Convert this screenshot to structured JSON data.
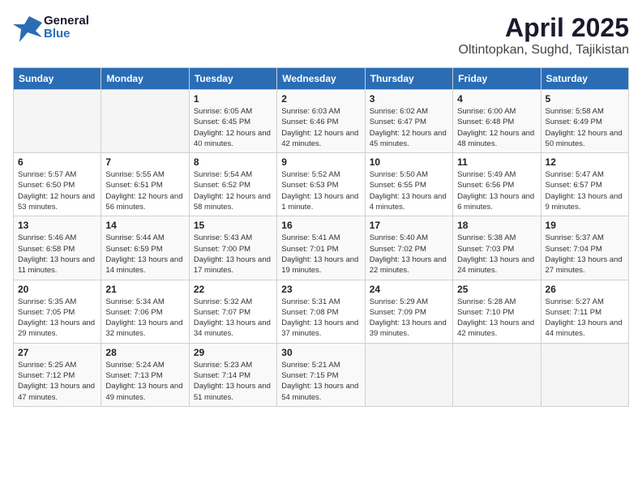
{
  "header": {
    "logo_general": "General",
    "logo_blue": "Blue",
    "title": "April 2025",
    "subtitle": "Oltintopkan, Sughd, Tajikistan"
  },
  "weekdays": [
    "Sunday",
    "Monday",
    "Tuesday",
    "Wednesday",
    "Thursday",
    "Friday",
    "Saturday"
  ],
  "weeks": [
    [
      {
        "day": "",
        "content": ""
      },
      {
        "day": "",
        "content": ""
      },
      {
        "day": "1",
        "content": "Sunrise: 6:05 AM\nSunset: 6:45 PM\nDaylight: 12 hours and 40 minutes."
      },
      {
        "day": "2",
        "content": "Sunrise: 6:03 AM\nSunset: 6:46 PM\nDaylight: 12 hours and 42 minutes."
      },
      {
        "day": "3",
        "content": "Sunrise: 6:02 AM\nSunset: 6:47 PM\nDaylight: 12 hours and 45 minutes."
      },
      {
        "day": "4",
        "content": "Sunrise: 6:00 AM\nSunset: 6:48 PM\nDaylight: 12 hours and 48 minutes."
      },
      {
        "day": "5",
        "content": "Sunrise: 5:58 AM\nSunset: 6:49 PM\nDaylight: 12 hours and 50 minutes."
      }
    ],
    [
      {
        "day": "6",
        "content": "Sunrise: 5:57 AM\nSunset: 6:50 PM\nDaylight: 12 hours and 53 minutes."
      },
      {
        "day": "7",
        "content": "Sunrise: 5:55 AM\nSunset: 6:51 PM\nDaylight: 12 hours and 56 minutes."
      },
      {
        "day": "8",
        "content": "Sunrise: 5:54 AM\nSunset: 6:52 PM\nDaylight: 12 hours and 58 minutes."
      },
      {
        "day": "9",
        "content": "Sunrise: 5:52 AM\nSunset: 6:53 PM\nDaylight: 13 hours and 1 minute."
      },
      {
        "day": "10",
        "content": "Sunrise: 5:50 AM\nSunset: 6:55 PM\nDaylight: 13 hours and 4 minutes."
      },
      {
        "day": "11",
        "content": "Sunrise: 5:49 AM\nSunset: 6:56 PM\nDaylight: 13 hours and 6 minutes."
      },
      {
        "day": "12",
        "content": "Sunrise: 5:47 AM\nSunset: 6:57 PM\nDaylight: 13 hours and 9 minutes."
      }
    ],
    [
      {
        "day": "13",
        "content": "Sunrise: 5:46 AM\nSunset: 6:58 PM\nDaylight: 13 hours and 11 minutes."
      },
      {
        "day": "14",
        "content": "Sunrise: 5:44 AM\nSunset: 6:59 PM\nDaylight: 13 hours and 14 minutes."
      },
      {
        "day": "15",
        "content": "Sunrise: 5:43 AM\nSunset: 7:00 PM\nDaylight: 13 hours and 17 minutes."
      },
      {
        "day": "16",
        "content": "Sunrise: 5:41 AM\nSunset: 7:01 PM\nDaylight: 13 hours and 19 minutes."
      },
      {
        "day": "17",
        "content": "Sunrise: 5:40 AM\nSunset: 7:02 PM\nDaylight: 13 hours and 22 minutes."
      },
      {
        "day": "18",
        "content": "Sunrise: 5:38 AM\nSunset: 7:03 PM\nDaylight: 13 hours and 24 minutes."
      },
      {
        "day": "19",
        "content": "Sunrise: 5:37 AM\nSunset: 7:04 PM\nDaylight: 13 hours and 27 minutes."
      }
    ],
    [
      {
        "day": "20",
        "content": "Sunrise: 5:35 AM\nSunset: 7:05 PM\nDaylight: 13 hours and 29 minutes."
      },
      {
        "day": "21",
        "content": "Sunrise: 5:34 AM\nSunset: 7:06 PM\nDaylight: 13 hours and 32 minutes."
      },
      {
        "day": "22",
        "content": "Sunrise: 5:32 AM\nSunset: 7:07 PM\nDaylight: 13 hours and 34 minutes."
      },
      {
        "day": "23",
        "content": "Sunrise: 5:31 AM\nSunset: 7:08 PM\nDaylight: 13 hours and 37 minutes."
      },
      {
        "day": "24",
        "content": "Sunrise: 5:29 AM\nSunset: 7:09 PM\nDaylight: 13 hours and 39 minutes."
      },
      {
        "day": "25",
        "content": "Sunrise: 5:28 AM\nSunset: 7:10 PM\nDaylight: 13 hours and 42 minutes."
      },
      {
        "day": "26",
        "content": "Sunrise: 5:27 AM\nSunset: 7:11 PM\nDaylight: 13 hours and 44 minutes."
      }
    ],
    [
      {
        "day": "27",
        "content": "Sunrise: 5:25 AM\nSunset: 7:12 PM\nDaylight: 13 hours and 47 minutes."
      },
      {
        "day": "28",
        "content": "Sunrise: 5:24 AM\nSunset: 7:13 PM\nDaylight: 13 hours and 49 minutes."
      },
      {
        "day": "29",
        "content": "Sunrise: 5:23 AM\nSunset: 7:14 PM\nDaylight: 13 hours and 51 minutes."
      },
      {
        "day": "30",
        "content": "Sunrise: 5:21 AM\nSunset: 7:15 PM\nDaylight: 13 hours and 54 minutes."
      },
      {
        "day": "",
        "content": ""
      },
      {
        "day": "",
        "content": ""
      },
      {
        "day": "",
        "content": ""
      }
    ]
  ]
}
